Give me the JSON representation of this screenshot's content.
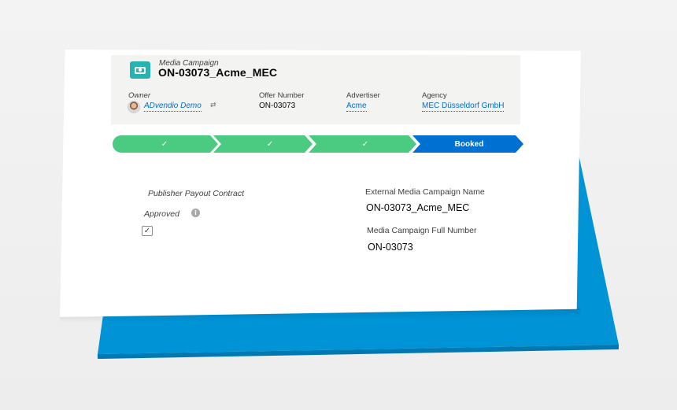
{
  "colors": {
    "blue_panel": "#0093d6",
    "stage_complete": "#4bca81",
    "stage_current": "#0070d2",
    "record_icon": "#28b3b3",
    "link": "#006dcc"
  },
  "record": {
    "object_type": "Media Campaign",
    "title": "ON-03073_Acme_MEC",
    "icon": "media-campaign-icon"
  },
  "highlights": {
    "owner_label": "Owner",
    "owner_value": "ADvendio Demo",
    "offer_number_label": "Offer Number",
    "offer_number_value": "ON-03073",
    "advertiser_label": "Advertiser",
    "advertiser_value": "Acme",
    "agency_label": "Agency",
    "agency_value": "MEC Düsseldorf GmbH"
  },
  "path": {
    "stages": [
      {
        "status": "complete",
        "icon": "check-icon",
        "label": "✓"
      },
      {
        "status": "complete",
        "icon": "check-icon",
        "label": "✓"
      },
      {
        "status": "complete",
        "icon": "check-icon",
        "label": "✓"
      },
      {
        "status": "current",
        "label": "Booked"
      }
    ]
  },
  "details": {
    "publisher_payout_label": "Publisher Payout Contract",
    "approved_label": "Approved",
    "approved_value": true,
    "approved_check": "✓",
    "info_glyph": "i",
    "external_name_label": "External Media Campaign Name",
    "external_name_value": "ON-03073_Acme_MEC",
    "full_number_label": "Media Campaign Full Number",
    "full_number_value": "ON-03073"
  },
  "owner_change_icon": "⇄"
}
